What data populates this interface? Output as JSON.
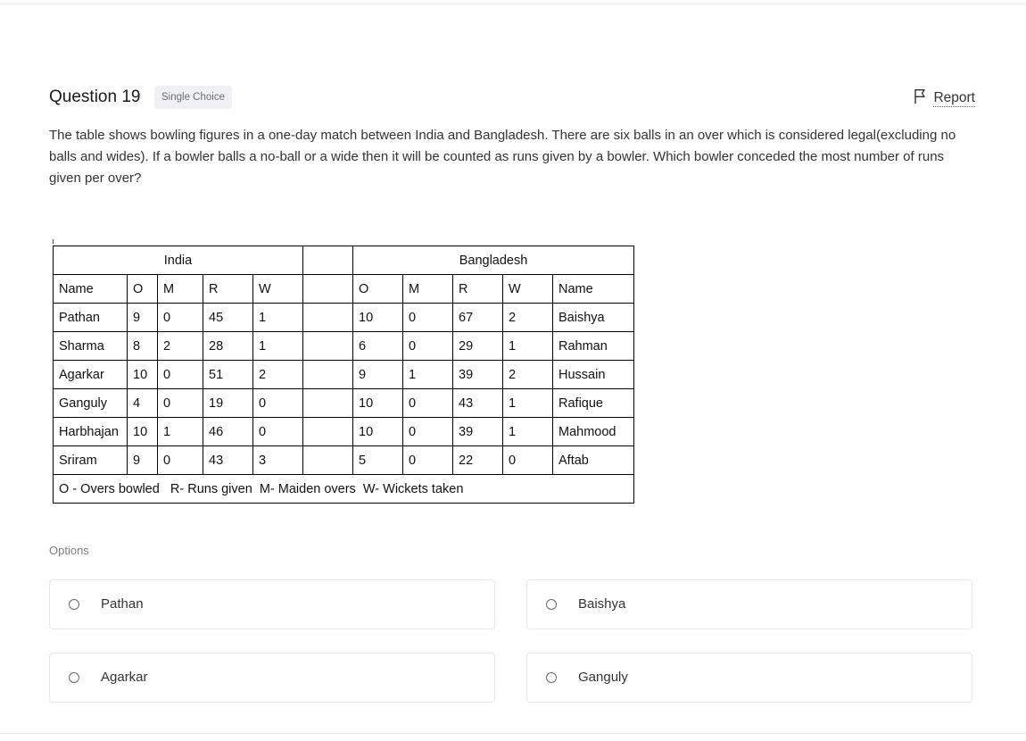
{
  "question": {
    "title": "Question 19",
    "type_badge": "Single Choice",
    "report_label": "Report",
    "text": "The table shows bowling figures in a one-day match between India and Bangladesh. There are six balls in an over which is considered legal(excluding no balls and wides). If a bowler balls a no-ball or a wide then it will be counted as runs given by a bowler. Which bowler conceded the most number of runs given per over?"
  },
  "table": {
    "teams": [
      "India",
      "Bangladesh"
    ],
    "india_headers": [
      "Name",
      "O",
      "M",
      "R",
      "W"
    ],
    "bangladesh_headers": [
      "O",
      "M",
      "R",
      "W",
      "Name"
    ],
    "rows": [
      {
        "india": [
          "Pathan",
          "9",
          "0",
          "45",
          "1"
        ],
        "bangladesh": [
          "10",
          "0",
          "67",
          "2",
          "Baishya"
        ]
      },
      {
        "india": [
          "Sharma",
          "8",
          "2",
          "28",
          "1"
        ],
        "bangladesh": [
          "6",
          "0",
          "29",
          "1",
          "Rahman"
        ]
      },
      {
        "india": [
          "Agarkar",
          "10",
          "0",
          "51",
          "2"
        ],
        "bangladesh": [
          "9",
          "1",
          "39",
          "2",
          "Hussain"
        ]
      },
      {
        "india": [
          "Ganguly",
          "4",
          "0",
          "19",
          "0"
        ],
        "bangladesh": [
          "10",
          "0",
          "43",
          "1",
          "Rafique"
        ]
      },
      {
        "india": [
          "Harbhajan",
          "10",
          "1",
          "46",
          "0"
        ],
        "bangladesh": [
          "10",
          "0",
          "39",
          "1",
          "Mahmood"
        ]
      },
      {
        "india": [
          "Sriram",
          "9",
          "0",
          "43",
          "3"
        ],
        "bangladesh": [
          "5",
          "0",
          "22",
          "0",
          "Aftab"
        ]
      }
    ],
    "legend": "O - Overs bowled   R- Runs given  M- Maiden overs  W- Wickets taken"
  },
  "options_label": "Options",
  "options": [
    "Pathan",
    "Baishya",
    "Agarkar",
    "Ganguly"
  ]
}
